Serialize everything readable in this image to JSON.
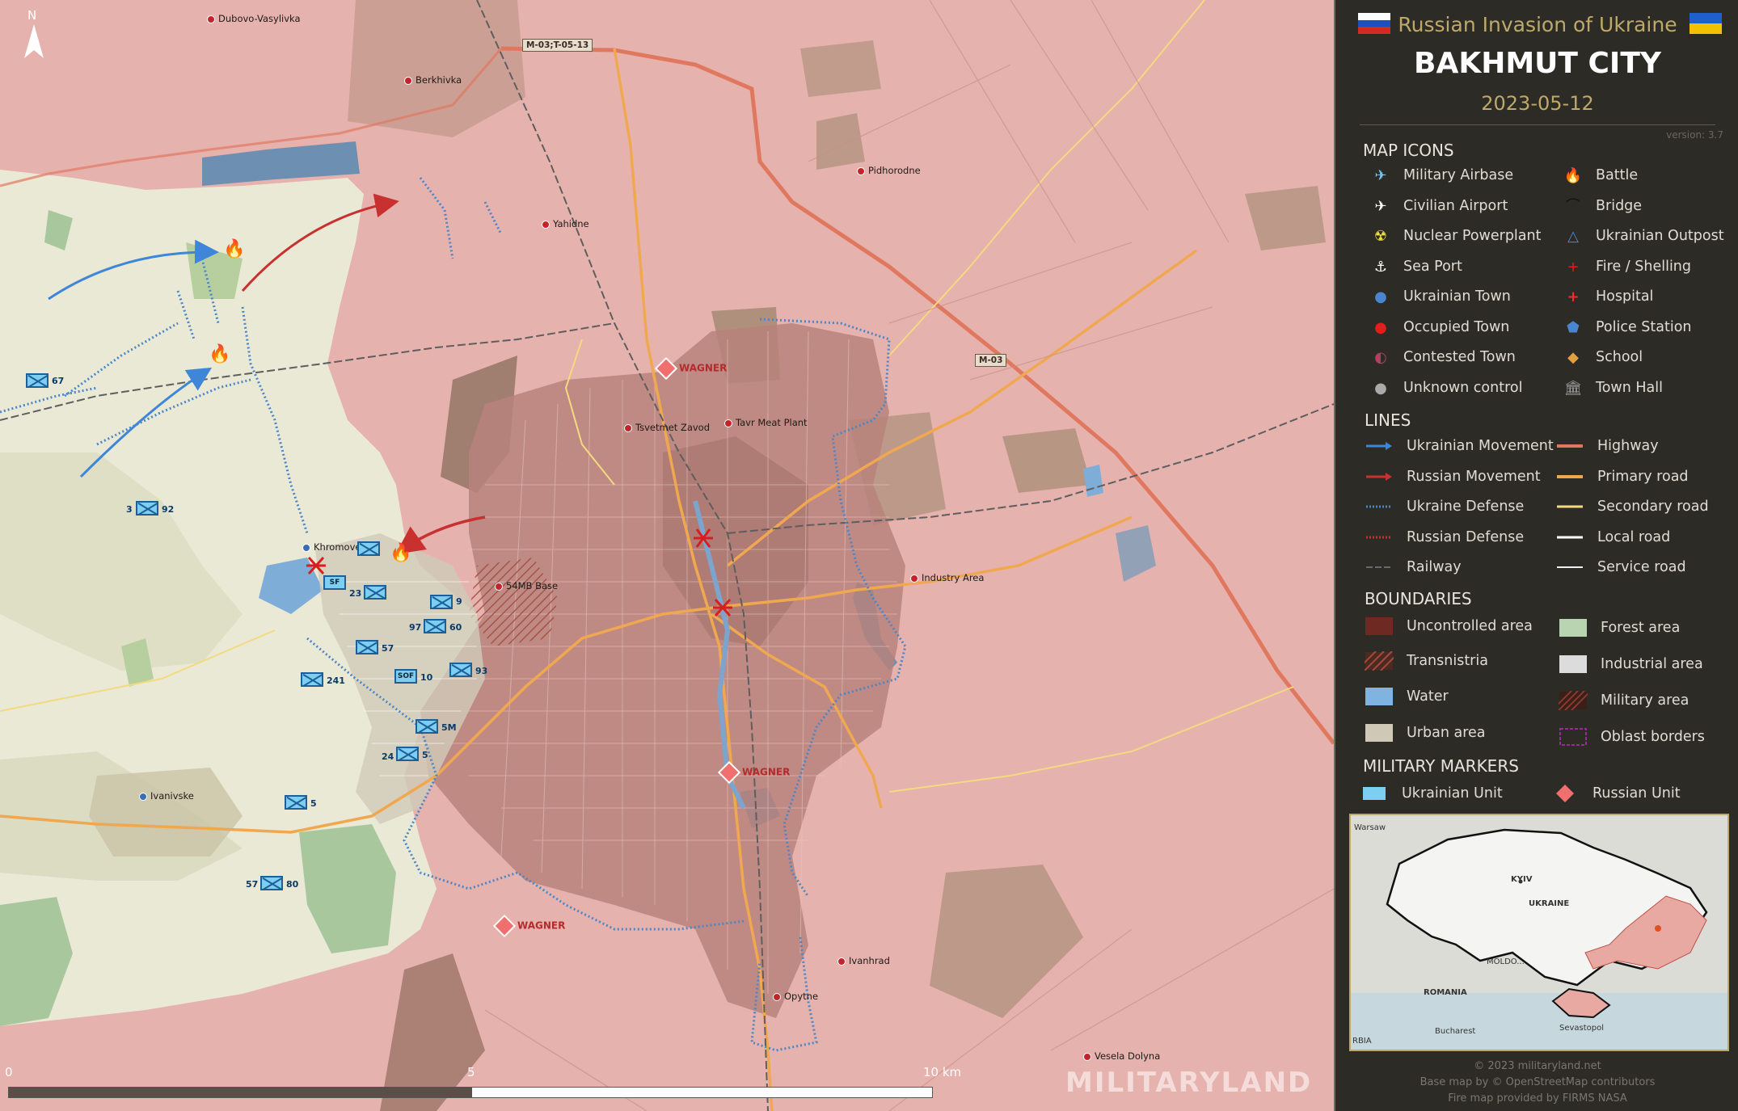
{
  "header": {
    "subtitle": "Russian Invasion of Ukraine",
    "title": "BAKHMUT CITY",
    "date": "2023-05-12",
    "version": "version: 3.7"
  },
  "map": {
    "places": {
      "dubovo": "Dubovo-Vasylivka",
      "berkhivka": "Berkhivka",
      "yahidne": "Yahidne",
      "pidhorodne": "Pidhorodne",
      "tsvetmet": "Tsvetmet Zavod",
      "tavr": "Tavr Meat Plant",
      "khromove": "Khromove",
      "base54": "54MB Base",
      "industry": "Industry Area",
      "ivanivske": "Ivanivske",
      "ivanhrad": "Ivanhrad",
      "opytne": "Opytne",
      "vesela": "Vesela Dolyna"
    },
    "roads": {
      "m03_t0513": "M-03;T-05-13",
      "m03": "M-03"
    },
    "wagner_label": "WAGNER",
    "units": {
      "u67": "67",
      "u3": "3",
      "u92": "92",
      "u23": "23",
      "u9": "9",
      "u97": "97",
      "u60": "60",
      "u57a": "57",
      "u10": "10",
      "u93": "93",
      "u241": "241",
      "u5m": "5M",
      "u24": "24",
      "u5a": "5",
      "u5b": "5",
      "u57b": "57",
      "u80": "80",
      "sf": "SF",
      "sof": "SOF"
    },
    "scale": {
      "zero": "0",
      "five": "5",
      "ten": "10 km"
    },
    "compass": "N",
    "watermark": "MILITARYLAND"
  },
  "legend": {
    "map_icons_title": "MAP ICONS",
    "map_icons": [
      {
        "label": "Military Airbase",
        "icon": "military-airbase-icon"
      },
      {
        "label": "Civilian Airport",
        "icon": "civilian-airport-icon"
      },
      {
        "label": "Nuclear Powerplant",
        "icon": "nuclear-icon"
      },
      {
        "label": "Sea Port",
        "icon": "anchor-icon"
      },
      {
        "label": "Ukrainian Town",
        "icon": "blue-dot-icon"
      },
      {
        "label": "Occupied Town",
        "icon": "red-dot-icon"
      },
      {
        "label": "Contested Town",
        "icon": "half-dot-icon"
      },
      {
        "label": "Unknown control",
        "icon": "grey-dot-icon"
      },
      {
        "label": "Battle",
        "icon": "fire-icon"
      },
      {
        "label": "Bridge",
        "icon": "bridge-icon"
      },
      {
        "label": "Ukrainian Outpost",
        "icon": "outpost-icon"
      },
      {
        "label": "Fire / Shelling",
        "icon": "shelling-icon"
      },
      {
        "label": "Hospital",
        "icon": "hospital-icon"
      },
      {
        "label": "Police Station",
        "icon": "police-icon"
      },
      {
        "label": "School",
        "icon": "school-icon"
      },
      {
        "label": "Town Hall",
        "icon": "town-hall-icon"
      }
    ],
    "lines_title": "LINES",
    "lines": [
      {
        "label": "Ukrainian Movement",
        "color": "#3d86d8"
      },
      {
        "label": "Russian Movement",
        "color": "#c93030"
      },
      {
        "label": "Ukraine Defense",
        "color": "#4a86c8"
      },
      {
        "label": "Russian Defense",
        "color": "#c93030"
      },
      {
        "label": "Railway",
        "color": "#6a6a6a"
      },
      {
        "label": "Highway",
        "color": "#e07860"
      },
      {
        "label": "Primary road",
        "color": "#f0a850"
      },
      {
        "label": "Secondary road",
        "color": "#f3da80"
      },
      {
        "label": "Local road",
        "color": "#ffffff"
      },
      {
        "label": "Service road",
        "color": "#eeeeee"
      }
    ],
    "boundaries_title": "BOUNDARIES",
    "boundaries": [
      {
        "label": "Uncontrolled area",
        "color": "#6e2a22"
      },
      {
        "label": "Transnistria",
        "color": "#7a3328"
      },
      {
        "label": "Water",
        "color": "#7fb3e0"
      },
      {
        "label": "Urban area",
        "color": "#cfc8b6"
      },
      {
        "label": "Forest area",
        "color": "#b8d4b0"
      },
      {
        "label": "Industrial area",
        "color": "#dcdcdc"
      },
      {
        "label": "Military area",
        "color": "#8a3a30"
      },
      {
        "label": "Oblast borders",
        "color": "#9a2a9a"
      }
    ],
    "military_title": "MILITARY MARKERS",
    "military": [
      {
        "label": "Ukrainian Unit",
        "color": "#7ccff0"
      },
      {
        "label": "Russian Unit",
        "color": "#f07070"
      }
    ]
  },
  "inset": {
    "warsaw": "Warsaw",
    "kyiv": "KYIV",
    "ukraine": "UKRAINE",
    "moldova": "MOLDO...",
    "romania": "ROMANIA",
    "bucharest": "Bucharest",
    "sevastopol": "Sevastopol",
    "serbia": "RBIA"
  },
  "credits": {
    "line1": "© 2023 militaryland.net",
    "line2": "Base map by © OpenStreetMap contributors",
    "line3": "Fire map provided by FIRMS NASA"
  }
}
